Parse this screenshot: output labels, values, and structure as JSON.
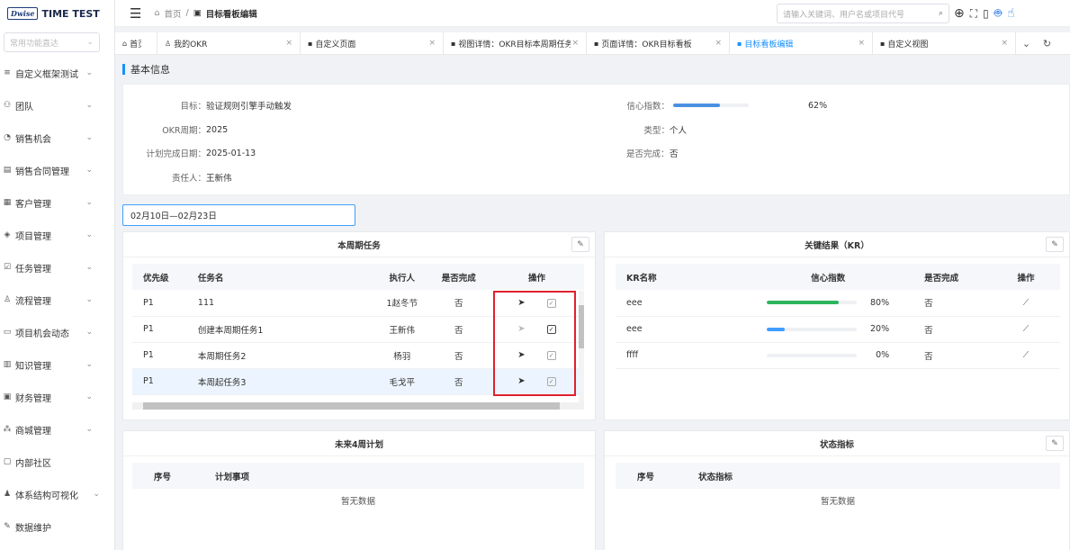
{
  "app": {
    "logo_badge": "Dwise",
    "logo_text": "TIME TEST"
  },
  "sidebar": {
    "search_placeholder": "常用功能直达",
    "items": [
      {
        "icon": "list-icon",
        "glyph": "≡",
        "label": "自定义框架测试"
      },
      {
        "icon": "team-icon",
        "glyph": "⚇",
        "label": "团队"
      },
      {
        "icon": "pie-icon",
        "glyph": "◔",
        "label": "销售机会"
      },
      {
        "icon": "contract-icon",
        "glyph": "▤",
        "label": "销售合同管理"
      },
      {
        "icon": "customer-icon",
        "glyph": "▦",
        "label": "客户管理"
      },
      {
        "icon": "layers-icon",
        "glyph": "◈",
        "label": "项目管理"
      },
      {
        "icon": "task-icon",
        "glyph": "☑",
        "label": "任务管理"
      },
      {
        "icon": "user-icon",
        "glyph": "♙",
        "label": "流程管理"
      },
      {
        "icon": "calendar-icon",
        "glyph": "▭",
        "label": "项目机会动态"
      },
      {
        "icon": "book-icon",
        "glyph": "▥",
        "label": "知识管理"
      },
      {
        "icon": "finance-icon",
        "glyph": "▣",
        "label": "财务管理"
      },
      {
        "icon": "mall-icon",
        "glyph": "⁂",
        "label": "商城管理"
      },
      {
        "icon": "community-icon",
        "glyph": "▢",
        "label": "内部社区"
      },
      {
        "icon": "org-icon",
        "glyph": "♟",
        "label": "体系结构可视化"
      },
      {
        "icon": "wrench-icon",
        "glyph": "✎",
        "label": "数据维护"
      }
    ]
  },
  "topbar": {
    "breadcrumb_home": "首页",
    "breadcrumb_sep": "/",
    "breadcrumb_current": "目标看板编辑",
    "search_placeholder": "请输入关键词、用户名或项目代号"
  },
  "tabs": [
    {
      "label": "首页",
      "closable": false
    },
    {
      "label": "我的OKR",
      "closable": true
    },
    {
      "label": "自定义页面",
      "closable": true
    },
    {
      "label": "视图详情：OKR目标本周期任务",
      "closable": true
    },
    {
      "label": "页面详情：OKR目标看板",
      "closable": true
    },
    {
      "label": "目标看板编辑",
      "closable": true,
      "active": true
    },
    {
      "label": "自定义视图",
      "closable": true
    }
  ],
  "basic": {
    "section_title": "基本信息",
    "goal_label": "目标：",
    "goal_value": "验证规则引擎手动触发",
    "period_label": "OKR周期：",
    "period_value": "2025",
    "due_label": "计划完成日期：",
    "due_value": "2025-01-13",
    "owner_label": "责任人：",
    "owner_value": "王新伟",
    "confidence_label": "信心指数：",
    "confidence_value": 0.62,
    "confidence_text": "62%",
    "type_label": "类型：",
    "type_value": "个人",
    "done_label": "是否完成：",
    "done_value": "否"
  },
  "date_range": "02月10日—02月23日",
  "tasks_panel": {
    "title": "本周期任务",
    "headers": [
      "优先级",
      "任务名",
      "执行人",
      "是否完成",
      "操作"
    ],
    "rows": [
      {
        "priority": "P1",
        "name": "111",
        "assignee": "1赵冬节",
        "done": "否",
        "send_enabled": true,
        "checked": false
      },
      {
        "priority": "P1",
        "name": "创建本周期任务1",
        "assignee": "王新伟",
        "done": "否",
        "send_enabled": false,
        "checked": true
      },
      {
        "priority": "P1",
        "name": "本周期任务2",
        "assignee": "杨羽",
        "done": "否",
        "send_enabled": true,
        "checked": false
      },
      {
        "priority": "P1",
        "name": "本周起任务3",
        "assignee": "毛戈平",
        "done": "否",
        "send_enabled": true,
        "checked": false
      }
    ]
  },
  "kr_panel": {
    "title": "关键结果（KR）",
    "headers": [
      "KR名称",
      "信心指数",
      "是否完成",
      "操作"
    ],
    "rows": [
      {
        "name": "eee",
        "confidence": 0.8,
        "confidence_text": "80%",
        "done": "否",
        "color": "#2db55d"
      },
      {
        "name": "eee",
        "confidence": 0.2,
        "confidence_text": "20%",
        "done": "否",
        "color": "#409eff"
      },
      {
        "name": "ffff",
        "confidence": 0.0,
        "confidence_text": "0%",
        "done": "否",
        "color": "#409eff"
      }
    ]
  },
  "plan_panel": {
    "title": "未来4周计划",
    "headers": [
      "序号",
      "计划事项"
    ],
    "empty": "暂无数据"
  },
  "status_panel": {
    "title": "状态指标",
    "headers": [
      "序号",
      "状态指标"
    ],
    "empty": "暂无数据"
  }
}
